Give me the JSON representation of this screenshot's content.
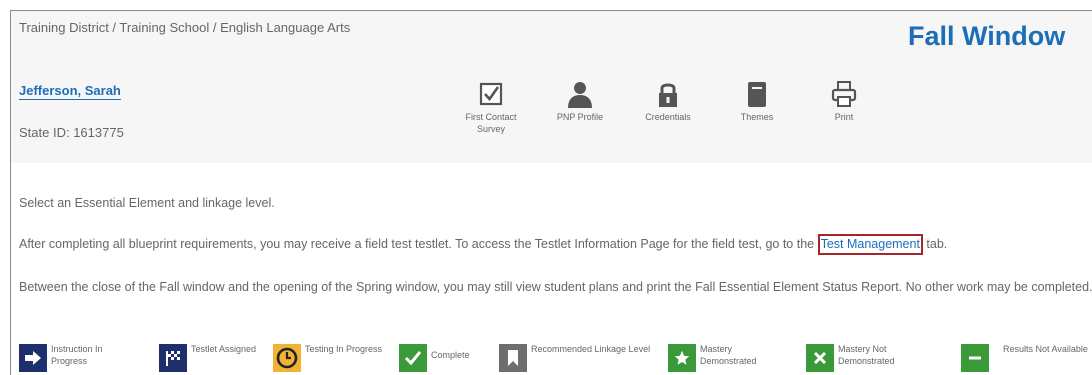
{
  "header": {
    "breadcrumb": "Training District / Training School / English Language Arts",
    "window_title": "Fall Window",
    "student_name": "Jefferson, Sarah",
    "state_id": "State ID: 1613775"
  },
  "toolbar": {
    "first_contact": "First Contact Survey",
    "pnp_profile": "PNP Profile",
    "credentials": "Credentials",
    "themes": "Themes",
    "print": "Print"
  },
  "messages": {
    "select": "Select an Essential Element and linkage level.",
    "field_test_before": "After completing all blueprint requirements, you may receive a field test testlet. To access the Testlet Information Page for the field test, go to the ",
    "field_test_link": "Test Management",
    "field_test_after": " tab.",
    "between_windows": "Between the close of the Fall window and the opening of the Spring window, you may still view student plans and print the Fall Essential Element Status Report. No other work may be completed."
  },
  "legend": {
    "instruction": "Instruction In Progress",
    "testlet": "Testlet Assigned",
    "testing": "Testing In Progress",
    "complete": "Complete",
    "recommended": "Recommended Linkage Level",
    "mastery": "Mastery Demonstrated",
    "not_mastery": "Mastery Not Demonstrated",
    "results": "Results Not Available"
  },
  "colors": {
    "link_blue": "#1d6eb6",
    "navy": "#1f2f6b",
    "gold": "#f2b233",
    "green": "#3a9a3a",
    "gray": "#6e6e6e",
    "highlight_red": "#a4262c"
  }
}
